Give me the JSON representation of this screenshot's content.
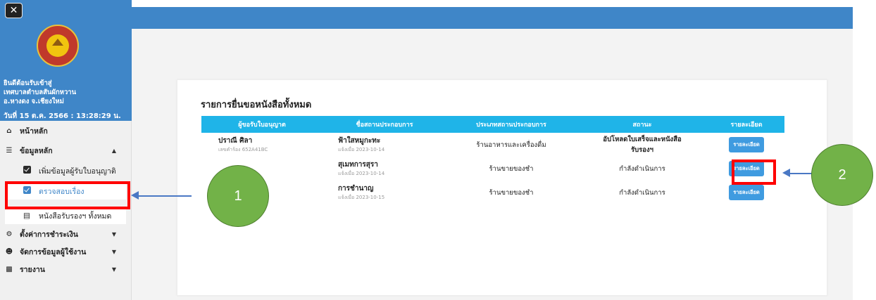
{
  "sidebar": {
    "close_label": "✕",
    "welcome_lines": [
      "ยินดีต้อนรับเข้าสู่",
      "เทศบาลตำบลสันผักหวาน",
      "อ.หางดง จ.เชียงใหม่"
    ],
    "date_time": "วันที่ 15 ต.ค. 2566 : 13:28:29 น.",
    "nav": [
      {
        "label": "หน้าหลัก",
        "icon": "home-icon"
      },
      {
        "label": "ข้อมูลหลัก",
        "icon": "database-icon",
        "expanded": true
      },
      {
        "label": "ตั้งค่าการชำระเงิน",
        "icon": "gear-icon"
      },
      {
        "label": "จัดการข้อมูลผู้ใช้งาน",
        "icon": "users-icon"
      },
      {
        "label": "รายงาน",
        "icon": "chart-icon"
      }
    ],
    "sub": [
      {
        "label": "เพิ่มข้อมูลผู้รับใบอนุญาติ",
        "icon": "checkbox-icon"
      },
      {
        "label": "ตรวจสอบเรื่อง",
        "icon": "checkbox-icon",
        "active": true
      },
      {
        "label": "หนังสือรับรองฯ ทั้งหมด",
        "icon": "document-icon"
      }
    ]
  },
  "main": {
    "title": "รายการยื่นขอหนังสือทั้งหมด",
    "columns": [
      "ผู้ขอรับใบอนุญาต",
      "ชื่อสถานประกอบการ",
      "ประเภทสถานประกอบการ",
      "สถานะ",
      "รายละเอียด"
    ],
    "rows": [
      {
        "applicant": "ปราณี ศิลา",
        "applicant_sub": "เลขคำร้อง 652A41BC",
        "business": "ฟ้าใสหมูกะทะ",
        "business_sub": "แจ้งเมื่อ 2023-10-14",
        "type": "ร้านอาหารและเครื่องดื่ม",
        "status_line1": "อัปโหลดใบเสร็จและหนังสือ",
        "status_line2": "รับรองฯ",
        "status_color": "#e53935",
        "detail": "รายละเอียด"
      },
      {
        "applicant": "",
        "applicant_sub": "",
        "business": "สุเมทการสุรา",
        "business_sub": "แจ้งเมื่อ 2023-10-14",
        "type": "ร้านขายของชำ",
        "status_line1": "กำลังดำเนินการ",
        "status_line2": "",
        "status_color": "#43b02a",
        "detail": "รายละเอียด"
      },
      {
        "applicant": "",
        "applicant_sub": "",
        "business": "การชำนาญ",
        "business_sub": "แจ้งเมื่อ 2023-10-15",
        "type": "ร้านขายของชำ",
        "status_line1": "กำลังดำเนินการ",
        "status_line2": "",
        "status_color": "#43b02a",
        "detail": "รายละเอียด"
      }
    ]
  },
  "annotations": {
    "marker_1": "1",
    "marker_2": "2",
    "box_color": "#ff0000",
    "arrow_color": "#4a78c4",
    "marker_color": "#72b248"
  }
}
